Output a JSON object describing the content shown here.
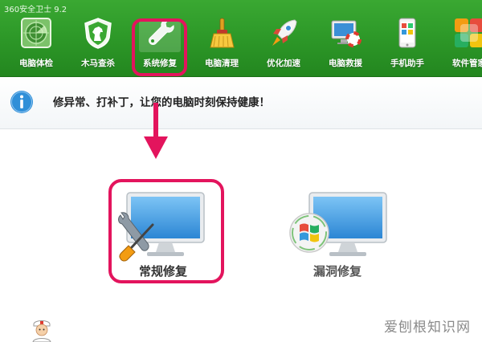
{
  "app": {
    "title": "360安全卫士 9.2"
  },
  "toolbar": {
    "items": [
      {
        "label": "电脑体检",
        "icon": "radar-icon"
      },
      {
        "label": "木马查杀",
        "icon": "horse-shield-icon"
      },
      {
        "label": "系统修复",
        "icon": "wrench-icon",
        "active": true
      },
      {
        "label": "电脑清理",
        "icon": "broom-icon"
      },
      {
        "label": "优化加速",
        "icon": "rocket-icon"
      },
      {
        "label": "电脑救援",
        "icon": "monitor-lifebuoy-icon"
      },
      {
        "label": "手机助手",
        "icon": "phone-icon"
      },
      {
        "label": "软件管家",
        "icon": "apps-grid-icon"
      }
    ]
  },
  "banner": {
    "text": "修异常、打补丁，让您的电脑时刻保持健康！",
    "icon": "info-icon"
  },
  "options": {
    "normal": {
      "label": "常规修复",
      "icon": "monitor-tools-icon"
    },
    "vuln": {
      "label": "漏洞修复",
      "icon": "monitor-windows-icon"
    }
  },
  "watermark": "爱刨根知识网",
  "colors": {
    "toolbar_green": "#2e9a29",
    "highlight": "#e3145d",
    "info_blue": "#2f8fd8"
  }
}
